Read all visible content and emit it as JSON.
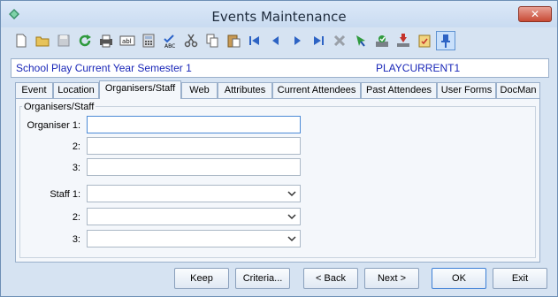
{
  "window": {
    "title": "Events Maintenance",
    "close_label": "✕"
  },
  "toolbar": {
    "buttons": [
      "new",
      "open",
      "save",
      "refresh",
      "print",
      "text-field",
      "calculator",
      "spell-check",
      "cut",
      "copy",
      "paste",
      "first",
      "previous",
      "next",
      "last",
      "delete",
      "cursor-select",
      "approve",
      "download",
      "clipboard-check",
      "pin"
    ]
  },
  "banner": {
    "event_name": "School Play Current Year Semester 1",
    "event_code": "PLAYCURRENT1"
  },
  "tabs": [
    "Event",
    "Location",
    "Organisers/Staff",
    "Web",
    "Attributes",
    "Current Attendees",
    "Past Attendees",
    "User Forms",
    "DocMan"
  ],
  "selected_tab": "Organisers/Staff",
  "form": {
    "group_label": "Organisers/Staff",
    "organiser_label": "Organiser 1:",
    "organiser2_label": "2:",
    "organiser3_label": "3:",
    "staff_label": "Staff 1:",
    "staff2_label": "2:",
    "staff3_label": "3:",
    "organiser1_value": "",
    "organiser2_value": "",
    "organiser3_value": "",
    "staff1_value": "",
    "staff2_value": "",
    "staff3_value": ""
  },
  "buttons": {
    "keep": "Keep",
    "criteria": "Criteria...",
    "back": "< Back",
    "next": "Next >",
    "ok": "OK",
    "exit": "Exit"
  },
  "colors": {
    "banner_text": "#1a27b8",
    "focus_border": "#4b8ad6"
  }
}
